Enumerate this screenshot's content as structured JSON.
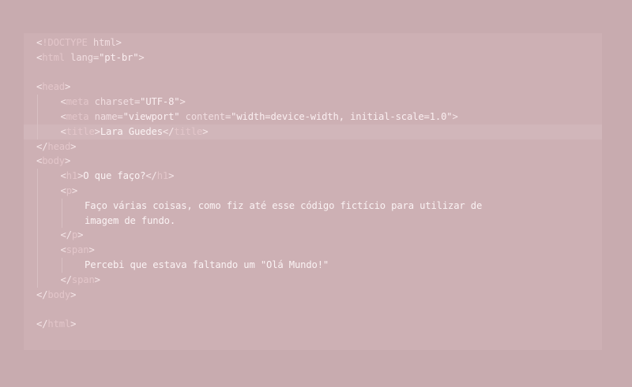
{
  "code_lines": [
    {
      "indent": 0,
      "doctype": "!DOCTYPE",
      "doctype_rest": " html"
    },
    {
      "indent": 0,
      "open": "html",
      "attr": "lang",
      "value": "\"pt-br\""
    },
    {
      "indent": 0,
      "blank": true
    },
    {
      "indent": 0,
      "open": "head"
    },
    {
      "indent": 1,
      "open": "meta",
      "attr": "charset",
      "value": "\"UTF-8\""
    },
    {
      "indent": 1,
      "open": "meta",
      "attr": "name",
      "value": "\"viewport\"",
      "attr2": "content",
      "value2": "\"width=device-width, initial-scale=1.0\""
    },
    {
      "indent": 1,
      "open": "title",
      "text": "Lara Guedes",
      "close": "title",
      "highlight": true
    },
    {
      "indent": 0,
      "close_only": "head"
    },
    {
      "indent": 0,
      "open": "body"
    },
    {
      "indent": 1,
      "open": "h1",
      "text": "O que faço?",
      "close": "h1"
    },
    {
      "indent": 1,
      "open": "p"
    },
    {
      "indent": 2,
      "text": "Faço várias coisas, como fiz até esse código fictício para utilizar de"
    },
    {
      "indent": 2,
      "text": "imagem de fundo."
    },
    {
      "indent": 1,
      "close_only": "p"
    },
    {
      "indent": 1,
      "open": "span"
    },
    {
      "indent": 2,
      "text": "Percebi que estava faltando um \"Olá Mundo!\""
    },
    {
      "indent": 1,
      "close_only": "span"
    },
    {
      "indent": 0,
      "close_only": "body"
    },
    {
      "indent": 0,
      "blank": true
    },
    {
      "indent": 0,
      "close_only": "html"
    }
  ]
}
